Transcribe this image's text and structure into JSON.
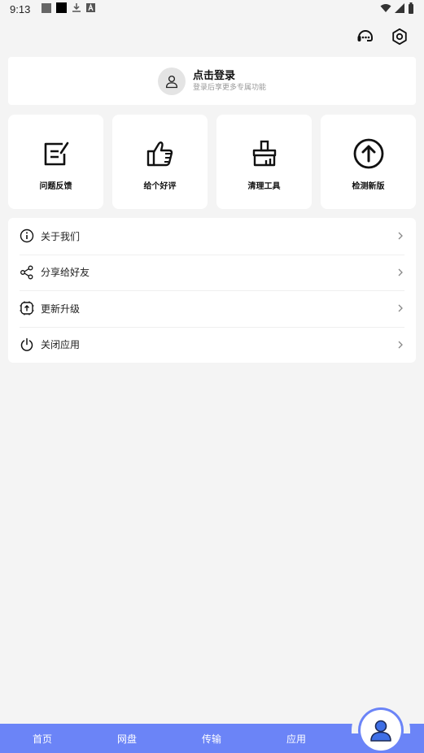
{
  "status_bar": {
    "time": "9:13"
  },
  "login": {
    "title": "点击登录",
    "subtitle": "登录后享更多专属功能"
  },
  "tiles": [
    {
      "label": "问题反馈",
      "icon": "feedback-icon"
    },
    {
      "label": "给个好评",
      "icon": "thumbs-up-icon"
    },
    {
      "label": "清理工具",
      "icon": "broom-icon"
    },
    {
      "label": "检测新版",
      "icon": "upload-arrow-icon"
    }
  ],
  "menu": [
    {
      "label": "关于我们",
      "icon": "info-icon"
    },
    {
      "label": "分享给好友",
      "icon": "share-icon"
    },
    {
      "label": "更新升级",
      "icon": "update-icon"
    },
    {
      "label": "关闭应用",
      "icon": "power-icon"
    }
  ],
  "bottom_nav": [
    {
      "label": "首页"
    },
    {
      "label": "网盘"
    },
    {
      "label": "传输"
    },
    {
      "label": "应用"
    }
  ],
  "colors": {
    "accent": "#6b84f7",
    "background": "#f4f4f4",
    "card": "#ffffff"
  }
}
